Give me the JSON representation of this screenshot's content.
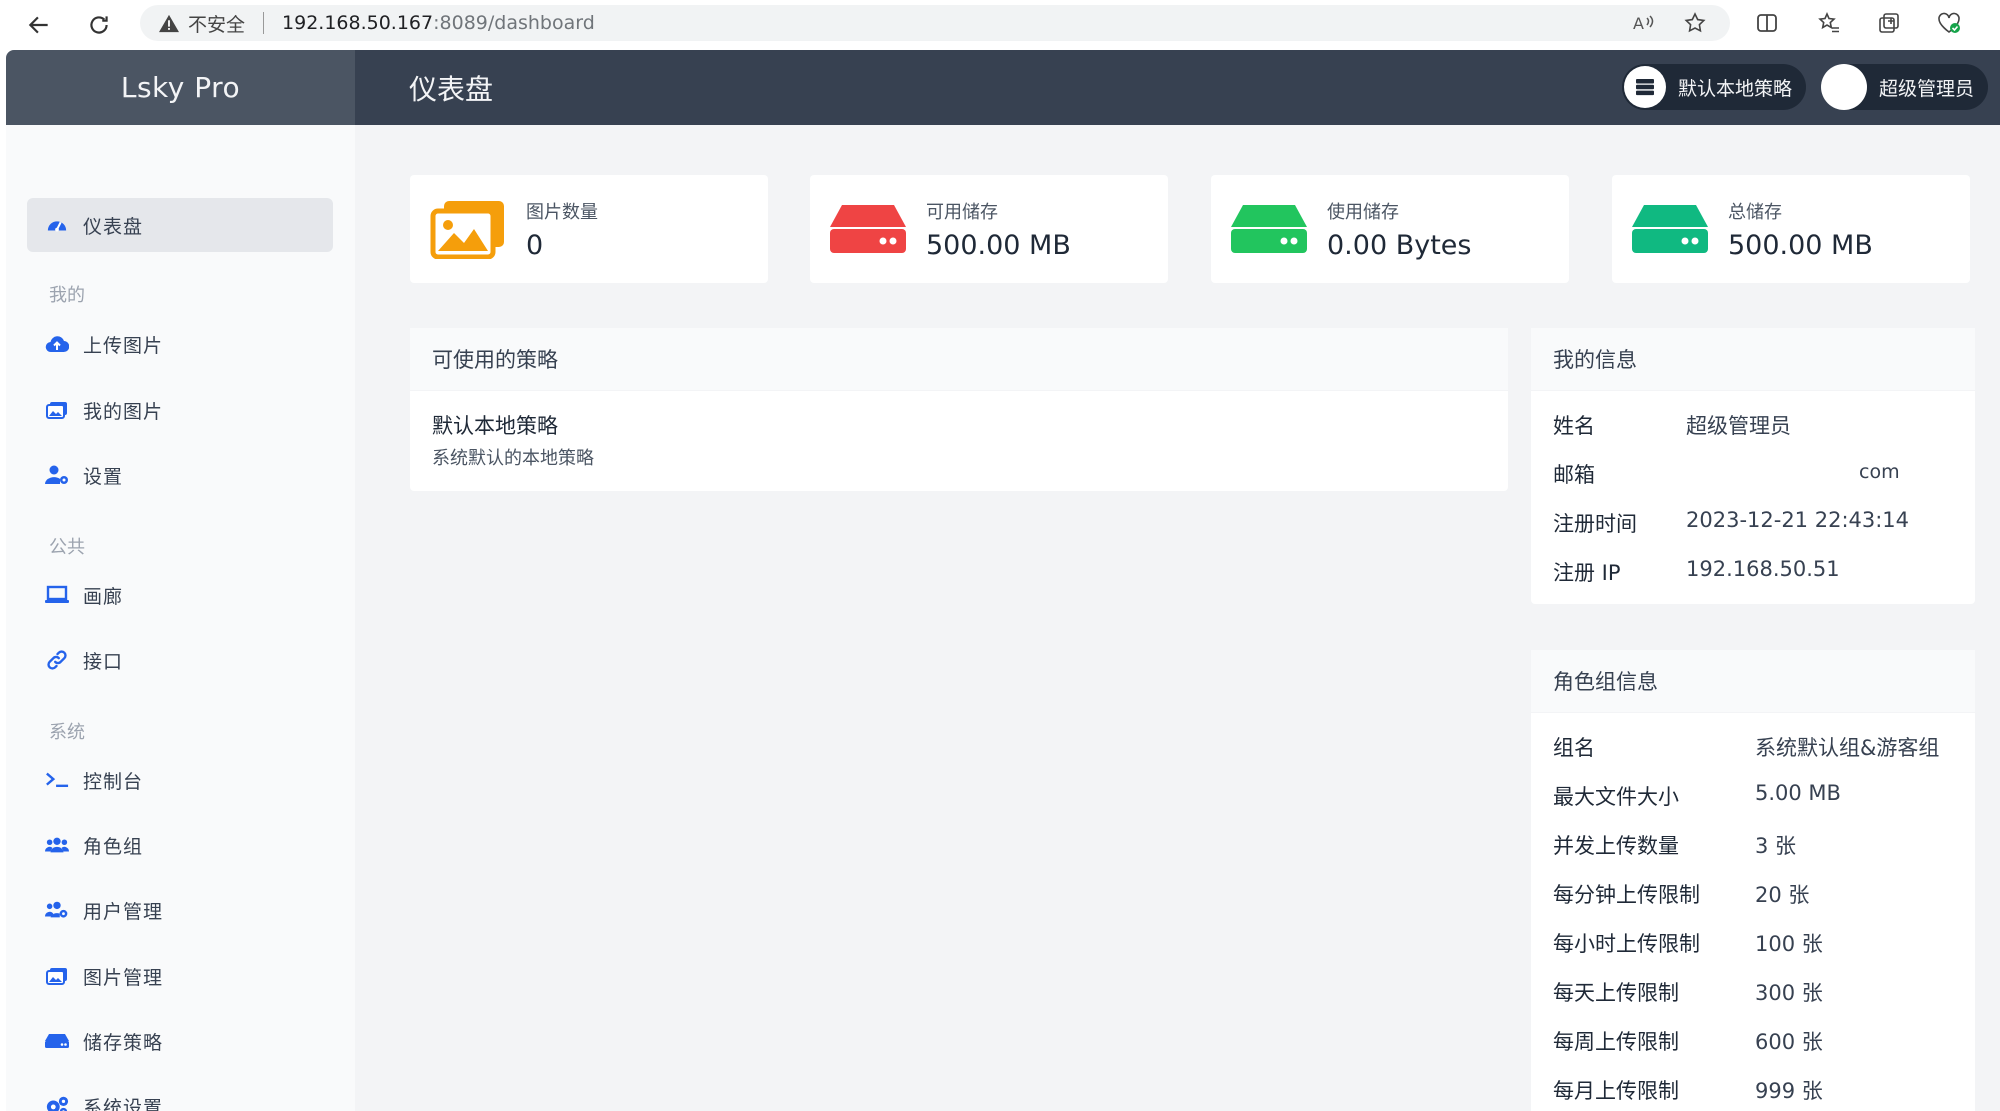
{
  "browser": {
    "security_label": "不安全",
    "url_host": "192.168.50.167",
    "url_path": ":8089/dashboard"
  },
  "app": {
    "brand": "Lsky Pro",
    "page_title": "仪表盘",
    "strategy_pill": "默认本地策略",
    "user_pill": "超级管理员"
  },
  "sidebar": {
    "dashboard": "仪表盘",
    "section_mine": "我的",
    "upload": "上传图片",
    "my_images": "我的图片",
    "settings": "设置",
    "section_public": "公共",
    "gallery": "画廊",
    "api": "接口",
    "section_system": "系统",
    "console": "控制台",
    "roles": "角色组",
    "users": "用户管理",
    "image_mgmt": "图片管理",
    "storage": "储存策略",
    "system_settings": "系统设置"
  },
  "stats": [
    {
      "label": "图片数量",
      "value": "0",
      "color": "#f59e0b"
    },
    {
      "label": "可用储存",
      "value": "500.00 MB",
      "color": "#ef4444"
    },
    {
      "label": "使用储存",
      "value": "0.00 Bytes",
      "color": "#22c55e"
    },
    {
      "label": "总储存",
      "value": "500.00 MB",
      "color": "#10b981"
    }
  ],
  "strategies": {
    "title": "可使用的策略",
    "name": "默认本地策略",
    "desc": "系统默认的本地策略"
  },
  "my_info": {
    "title": "我的信息",
    "rows": [
      {
        "k": "姓名",
        "v": "超级管理员"
      },
      {
        "k": "邮箱",
        "v": "com"
      },
      {
        "k": "注册时间",
        "v": "2023-12-21 22:43:14"
      },
      {
        "k": "注册 IP",
        "v": "192.168.50.51"
      }
    ]
  },
  "role_info": {
    "title": "角色组信息",
    "rows": [
      {
        "k": "组名",
        "v": "系统默认组&游客组"
      },
      {
        "k": "最大文件大小",
        "v": "5.00 MB"
      },
      {
        "k": "并发上传数量",
        "v": "3 张"
      },
      {
        "k": "每分钟上传限制",
        "v": "20 张"
      },
      {
        "k": "每小时上传限制",
        "v": "100 张"
      },
      {
        "k": "每天上传限制",
        "v": "300 张"
      },
      {
        "k": "每周上传限制",
        "v": "600 张"
      },
      {
        "k": "每月上传限制",
        "v": "999 张"
      }
    ]
  }
}
